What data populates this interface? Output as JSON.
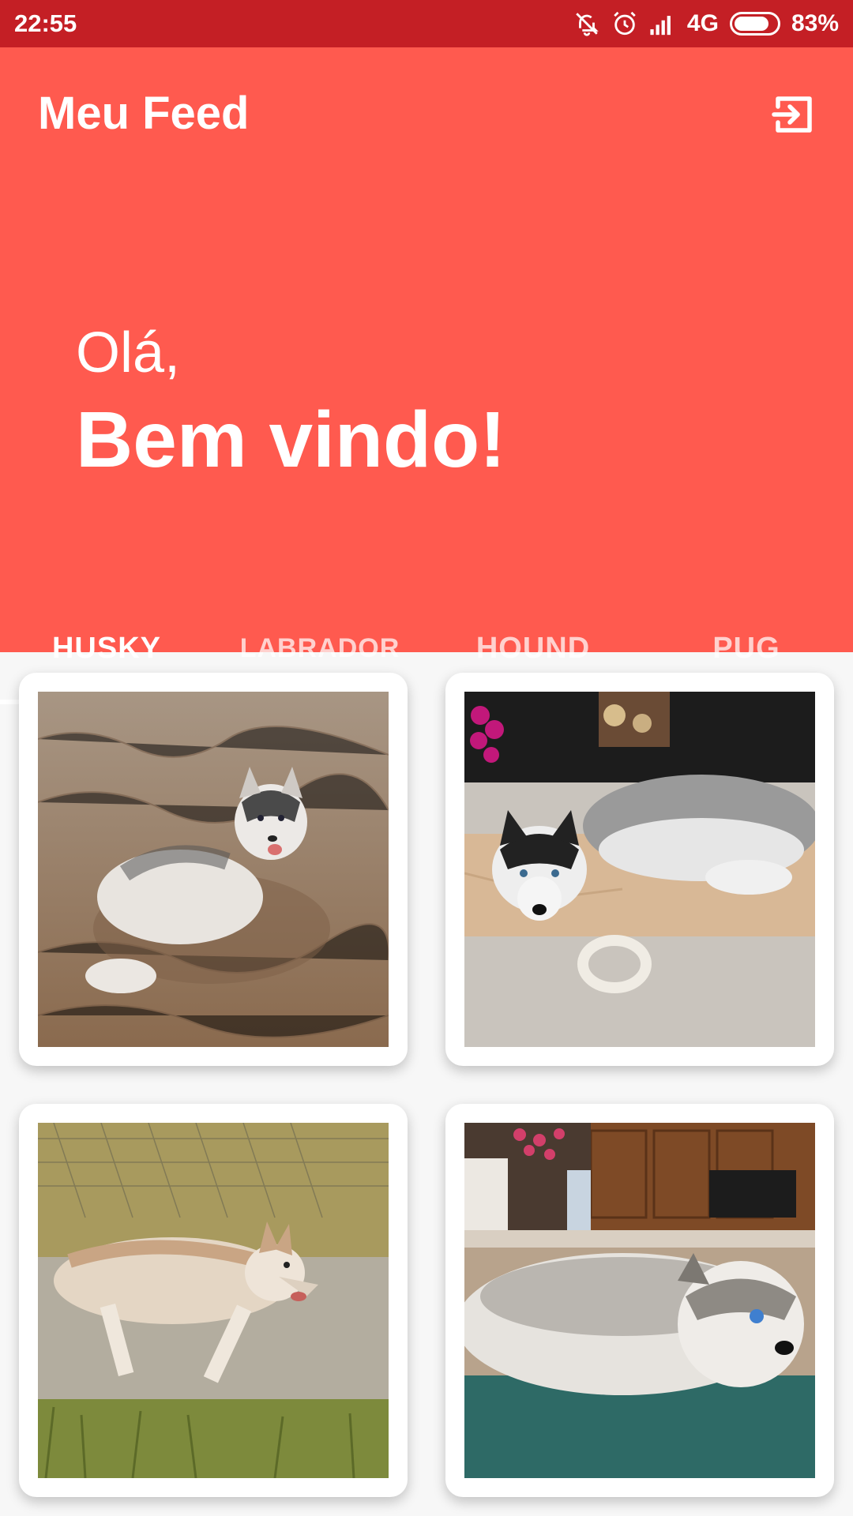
{
  "status_bar": {
    "time": "22:55",
    "network": "4G",
    "battery": "83%",
    "battery_level": 0.83,
    "icons": [
      "mute-icon",
      "alarm-icon",
      "signal-icon",
      "battery-icon"
    ]
  },
  "header": {
    "title": "Meu Feed",
    "logout_icon": "logout-icon",
    "greeting_small": "Olá,",
    "greeting_big": "Bem vindo!"
  },
  "tabs": {
    "selected": "HUSKY",
    "items": [
      {
        "label": "HUSKY"
      },
      {
        "label": "LABRADOR"
      },
      {
        "label": "HOUND"
      },
      {
        "label": "PUG"
      }
    ]
  },
  "colors": {
    "status_bar": "#c41f25",
    "header": "#ff5a4f",
    "background": "#f7f7f7",
    "card": "#ffffff"
  }
}
